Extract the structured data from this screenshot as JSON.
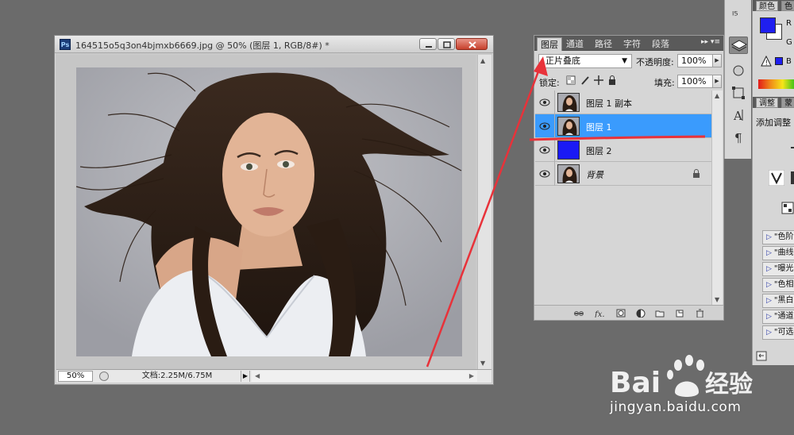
{
  "document": {
    "title": "164515o5q3on4bjmxb6669.jpg @ 50% (图层 1, RGB/8#) *",
    "app_badge": "Ps",
    "zoom": "50%",
    "doc_info": "文档:2.25M/6.75M"
  },
  "layers_panel": {
    "tabs": [
      "图层",
      "通道",
      "路径",
      "字符",
      "段落"
    ],
    "active_tab": 0,
    "blend_mode": "正片叠底",
    "opacity_label": "不透明度:",
    "opacity_value": "100%",
    "lock_label": "锁定:",
    "fill_label": "填充:",
    "fill_value": "100%",
    "layers": [
      {
        "name": "图层 1 副本",
        "selected": false,
        "thumb": "photo",
        "italic": false
      },
      {
        "name": "图层 1",
        "selected": true,
        "thumb": "photo",
        "italic": false
      },
      {
        "name": "图层 2",
        "selected": false,
        "thumb": "blue-fill",
        "italic": false
      },
      {
        "name": "背景",
        "selected": false,
        "thumb": "photo",
        "italic": true,
        "locked": true
      }
    ],
    "footer_icons": [
      "link-icon",
      "fx-icon",
      "mask-icon",
      "adjustment-icon",
      "group-icon",
      "new-layer-icon",
      "trash-icon"
    ]
  },
  "right_panels": {
    "color_tabs": [
      "颜色",
      "色"
    ],
    "r_label": "R",
    "g_label": "G",
    "b_label": "B",
    "adjust_tabs": [
      "调整",
      "蒙"
    ],
    "adjust_title": "添加调整",
    "presets": [
      "\"色阶",
      "\"曲线",
      "\"曝光",
      "\"色相",
      "\"黑白",
      "\"通道",
      "\"可选"
    ]
  },
  "watermark": {
    "brand": "Bai经验",
    "url": "jingyan.baidu.com"
  },
  "colors": {
    "selected_layer": "#3a9bfd",
    "layer2_fill": "#1a1af5",
    "annotation_red": "#e8323a",
    "foreground": "#1f1ff0"
  }
}
